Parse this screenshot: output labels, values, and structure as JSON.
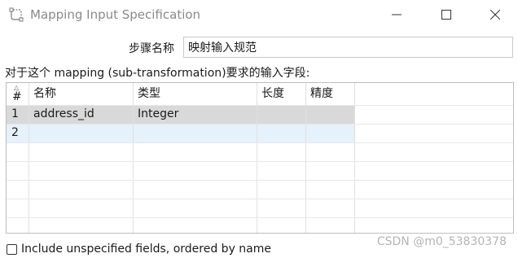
{
  "window": {
    "title": "Mapping Input Specification",
    "app_icon": "transformation-icon",
    "controls": [
      "minimize-icon",
      "maximize-icon",
      "close-icon"
    ]
  },
  "step": {
    "label": "步骤名称",
    "value": "映射输入规范"
  },
  "description": "对于这个 mapping (sub-transformation)要求的输入字段:",
  "table": {
    "columns": [
      "#",
      "名称",
      "类型",
      "长度",
      "精度"
    ],
    "rows": [
      {
        "num": "1",
        "name": "address_id",
        "type": "Integer",
        "length": "",
        "precision": ""
      },
      {
        "num": "2",
        "name": "",
        "type": "",
        "length": "",
        "precision": ""
      }
    ]
  },
  "include_unspecified": {
    "label": "Include unspecified fields, ordered by name",
    "checked": false
  },
  "watermark": "CSDN @m0_53830378"
}
